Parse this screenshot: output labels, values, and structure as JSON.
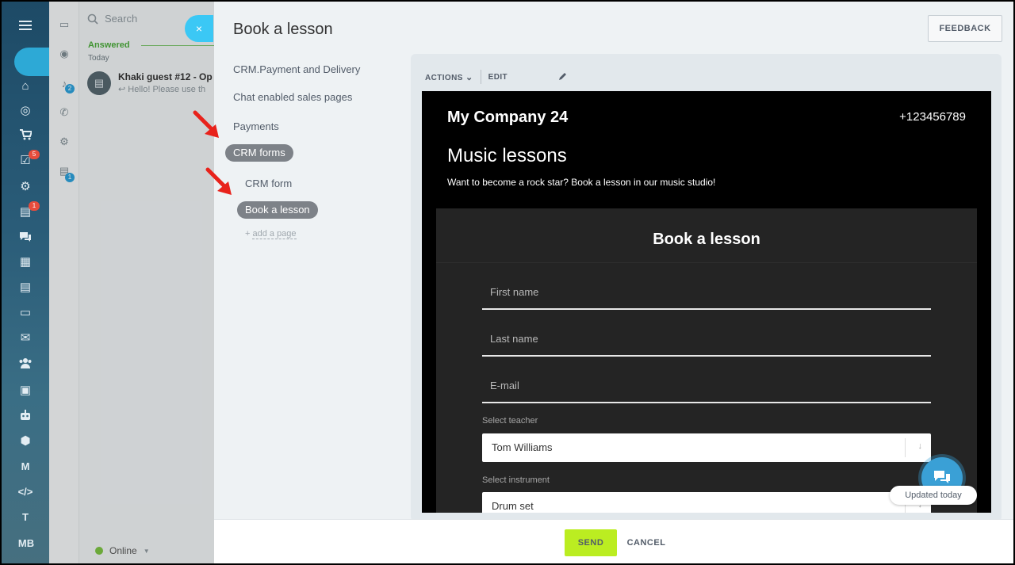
{
  "left_rail": {
    "icons": [
      "menu-icon",
      "home-icon",
      "target-icon",
      "cart-icon",
      "tasks-icon",
      "crm-icon",
      "calendar-feed-icon",
      "chat-icon",
      "calendar-icon",
      "document-icon",
      "drive-icon",
      "mail-icon",
      "group-icon",
      "contact-card-icon",
      "robot-icon",
      "box-icon",
      "market-icon",
      "code-icon"
    ],
    "badges": {
      "tasks": "5",
      "feed": "1"
    },
    "text_items": [
      "T",
      "MB"
    ]
  },
  "messenger": {
    "search_placeholder": "Search",
    "section_label": "Answered",
    "date_label": "Today",
    "chat": {
      "name": "Khaki guest #12 - Op",
      "preview": "Hello! Please use th"
    },
    "badges": {
      "notifications": "2",
      "tasks": "1"
    },
    "status": "Online"
  },
  "panel": {
    "title": "Book a lesson",
    "feedback_label": "FEEDBACK",
    "close_label": "×",
    "nav": {
      "items": [
        "CRM.Payment and Delivery",
        "Chat enabled sales pages",
        "Payments"
      ],
      "active_group": "CRM forms",
      "sub_item": "CRM form",
      "active_page": "Book a lesson",
      "add_prefix": "+ ",
      "add_page": "add a page"
    },
    "toolbar": {
      "actions_label": "ACTIONS",
      "edit_label": "EDIT"
    }
  },
  "site": {
    "company": "My Company 24",
    "phone": "+123456789",
    "headline": "Music lessons",
    "subline": "Want to become a rock star? Book a lesson in our music studio!",
    "form": {
      "title": "Book a lesson",
      "fields": [
        "First name",
        "Last name",
        "E-mail"
      ],
      "teacher_label": "Select teacher",
      "teacher_value": "Tom Williams",
      "instrument_label": "Select instrument",
      "instrument_value": "Drum set"
    }
  },
  "widget": {
    "updated_label": "Updated today"
  },
  "footer": {
    "send_label": "SEND",
    "cancel_label": "CANCEL"
  },
  "colors": {
    "accent": "#3bc8f5",
    "send": "#bbed21",
    "pill": "#7d8288",
    "arrow": "#e8221b"
  }
}
